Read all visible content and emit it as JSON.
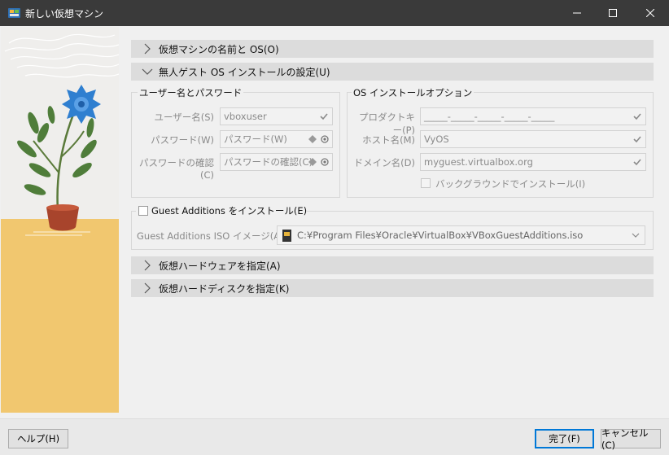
{
  "window": {
    "title": "新しい仮想マシン"
  },
  "sections": {
    "name_os": "仮想マシンの名前と OS(O)",
    "unattended": "無人ゲスト OS インストールの設定(U)",
    "hardware": "仮想ハードウェアを指定(A)",
    "disk": "仮想ハードディスクを指定(K)"
  },
  "user_group": {
    "title": "ユーザー名とパスワード",
    "username_label": "ユーザー名(S)",
    "username_value": "vboxuser",
    "password_label": "パスワード(W)",
    "password_value": "パスワード(W)",
    "confirm_label": "パスワードの確認(C)",
    "confirm_value": "パスワードの確認(C)"
  },
  "os_group": {
    "title": "OS インストールオプション",
    "product_key_label": "プロダクトキー(P)",
    "product_key_value": "_____-_____-_____-_____-_____",
    "hostname_label": "ホスト名(M)",
    "hostname_value": "VyOS",
    "domain_label": "ドメイン名(D)",
    "domain_value": "myguest.virtualbox.org",
    "background_install_label": "バックグラウンドでインストール(I)"
  },
  "guest_additions": {
    "checkbox_label": "Guest Additions をインストール(E)",
    "iso_label": "Guest Additions ISO イメージ(A):",
    "iso_path": "C:¥Program Files¥Oracle¥VirtualBox¥VBoxGuestAdditions.iso"
  },
  "footer": {
    "help": "ヘルプ(H)",
    "finish": "完了(F)",
    "cancel": "キャンセル(C)"
  },
  "colors": {
    "titlebar": "#3a3a3a",
    "section_header": "#dcdcdc",
    "accent": "#0078d7",
    "illustration_yellow": "#f1c76f",
    "flower_blue": "#2f7fd0"
  }
}
